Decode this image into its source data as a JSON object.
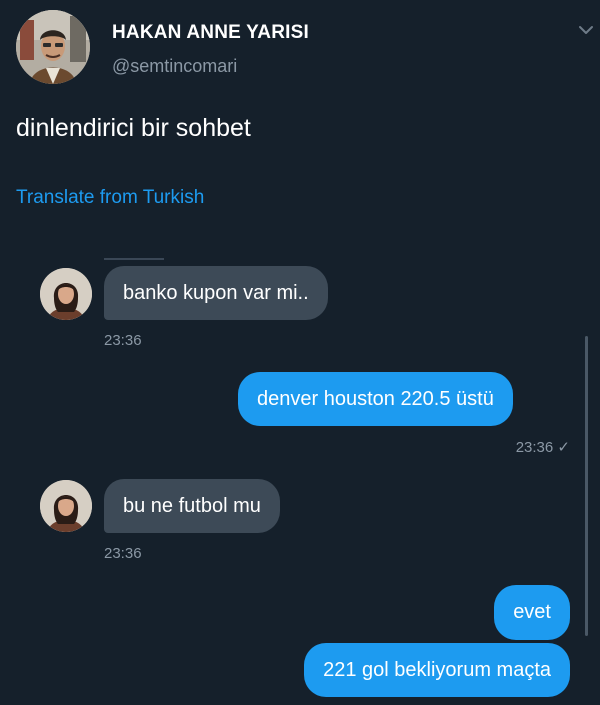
{
  "tweet": {
    "author_name": "HAKAN ANNE YARISI",
    "author_handle": "@semtincomari",
    "text": "dinlendirici bir sohbet",
    "translate_label": "Translate from Turkish",
    "menu_icon": "chevron-down-icon"
  },
  "chat": {
    "messages": [
      {
        "direction": "incoming",
        "text": "banko kupon var mi..",
        "time": "23:36"
      },
      {
        "direction": "outgoing",
        "text": "denver houston 220.5 üstü",
        "time": "23:36",
        "read_mark": "✓"
      },
      {
        "direction": "incoming",
        "text": "bu ne futbol mu",
        "time": "23:36"
      },
      {
        "direction": "outgoing",
        "text": "evet"
      },
      {
        "direction": "outgoing",
        "text": "221 gol bekliyorum maçta"
      }
    ]
  },
  "colors": {
    "background": "#15202b",
    "accent": "#1d9bf0",
    "incoming_bubble": "#3d4a57",
    "secondary_text": "#8b98a5"
  }
}
